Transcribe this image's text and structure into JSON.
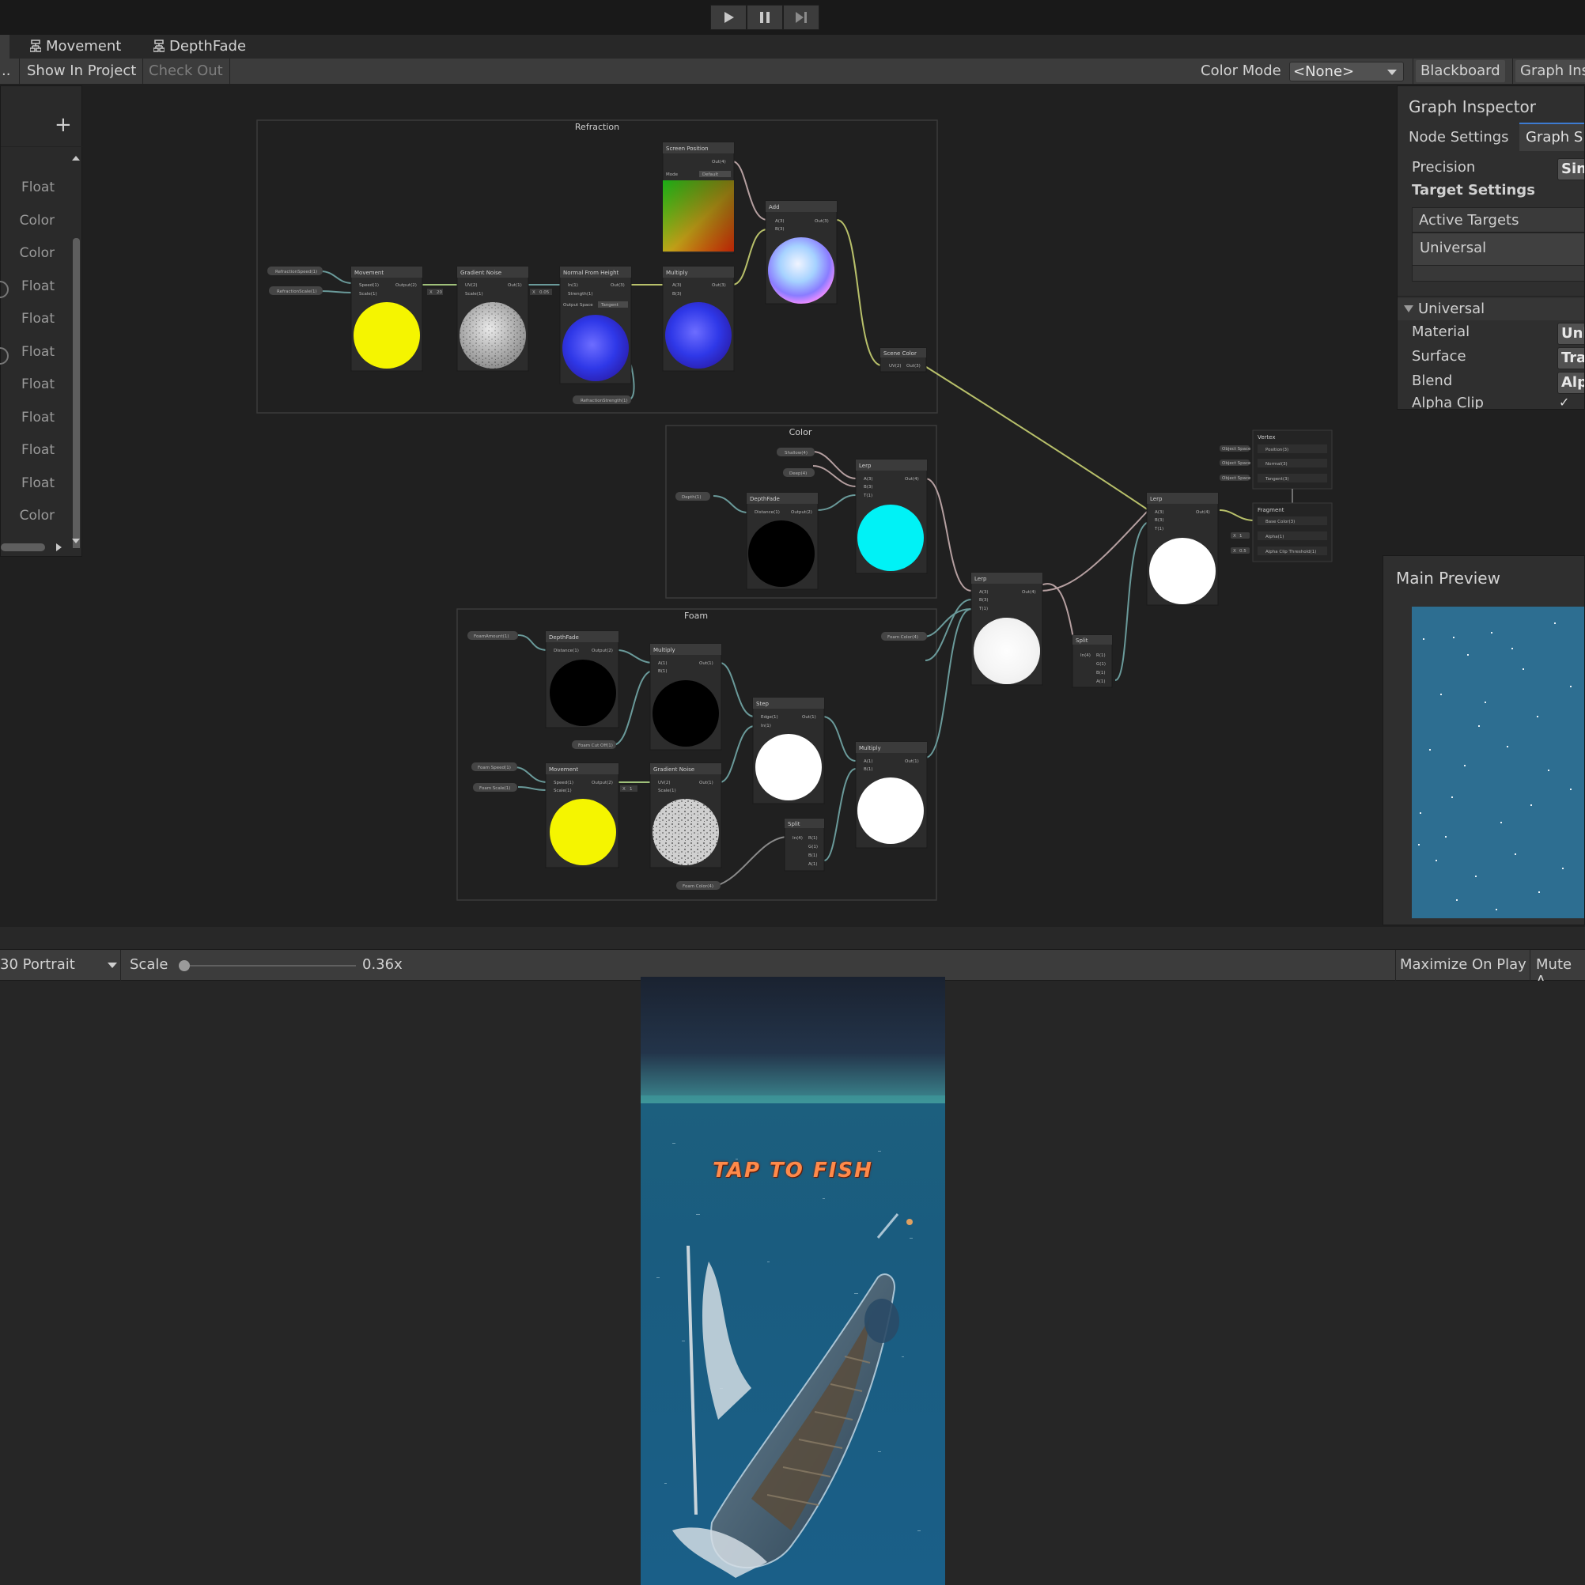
{
  "play_controls": {
    "play": "play-icon",
    "pause": "pause-icon",
    "step": "step-icon"
  },
  "tabs": {
    "left_fragment": "..",
    "movement": "Movement",
    "depthfade": "DepthFade"
  },
  "toolbar": {
    "show_in_project": "Show In Project",
    "check_out": "Check Out",
    "color_mode_label": "Color Mode",
    "color_mode_value": "<None>",
    "blackboard": "Blackboard",
    "graph_inspector": "Graph Ins"
  },
  "blackboard": {
    "add": "+",
    "types": [
      "Float",
      "Color",
      "Color",
      "Float",
      "Float",
      "Float",
      "Float",
      "Float",
      "Float",
      "Float",
      "Color"
    ]
  },
  "graph": {
    "groups": {
      "refraction": "Refraction",
      "color": "Color",
      "foam": "Foam"
    },
    "nodes": {
      "screen_position": "Screen Position",
      "mode": "Mode",
      "mode_value": "Default",
      "add": "Add",
      "movement": "Movement",
      "gradient_noise": "Gradient Noise",
      "normal_from_height": "Normal From Height",
      "output_space": "Output Space",
      "output_space_value": "Tangent",
      "multiply": "Multiply",
      "scene_color": "Scene Color",
      "lerp": "Lerp",
      "depthfade": "DepthFade",
      "step": "Step",
      "split": "Split",
      "vertex": "Vertex",
      "fragment": "Fragment"
    },
    "properties": {
      "refraction_speed": "RefractionSpeed(1)",
      "refraction_scale": "RefractionScale(1)",
      "refraction_strength": "RefractionStrength(1)",
      "shallow": "Shallow(4)",
      "deep": "Deep(4)",
      "depth": "Depth(1)",
      "foam_amount": "FoamAmount(1)",
      "foam_cutoff": "Foam Cut Off(1)",
      "foam_speed": "Foam Speed(1)",
      "foam_scale": "Foam Scale(1)",
      "foam_color": "Foam Color(4)",
      "foam_color_4": "Foam Color(4)"
    },
    "ports": {
      "speed": "Speed(1)",
      "scale": "Scale(1)",
      "output": "Output(2)",
      "uv": "UV(2)",
      "out1": "Out(1)",
      "in": "In(1)",
      "strength": "Strength(1)",
      "out3": "Out(3)",
      "a": "A(3)",
      "b": "B(3)",
      "out4": "Out(4)",
      "t": "T(1)",
      "distance": "Distance(1)",
      "edge": "Edge(1)",
      "r": "R(1)",
      "g": "G(1)",
      "bb": "B(1)",
      "aa": "A(1)",
      "in4": "In(4)",
      "position": "Position(3)",
      "normal": "Normal(3)",
      "tangent": "Tangent(3)",
      "base_color": "Base Color(3)",
      "alpha": "Alpha(1)",
      "alpha_clip": "Alpha Clip Threshold(1)",
      "object_space": "Object Space",
      "x": "X",
      "v20": "20",
      "v005": "0.05",
      "v1": "1",
      "v05": "0.5"
    }
  },
  "inspector": {
    "title": "Graph Inspector",
    "tab_node": "Node Settings",
    "tab_graph": "Graph S",
    "precision": "Precision",
    "precision_value": "Sing",
    "target_settings": "Target Settings",
    "active_targets": "Active Targets",
    "universal_target": "Universal",
    "section_universal": "Universal",
    "material": "Material",
    "material_value": "Unli",
    "surface": "Surface",
    "surface_value": "Tra",
    "blend": "Blend",
    "blend_value": "Alp",
    "alpha_clip": "Alpha Clip",
    "alpha_clip_check": "✓"
  },
  "main_preview": {
    "title": "Main Preview"
  },
  "game_view": {
    "resolution": "30 Portrait",
    "scale_label": "Scale",
    "scale_value": "0.36x",
    "scale_fraction": 0.0,
    "maximize_on_play": "Maximize On Play",
    "mute": "Mute A",
    "tap_text": "TAP TO FISH"
  },
  "colors": {
    "editor_bg": "#202020",
    "panel_bg": "#2f2f2f",
    "accent_tab": "#3d7bd1",
    "water": "#2d6e91"
  }
}
